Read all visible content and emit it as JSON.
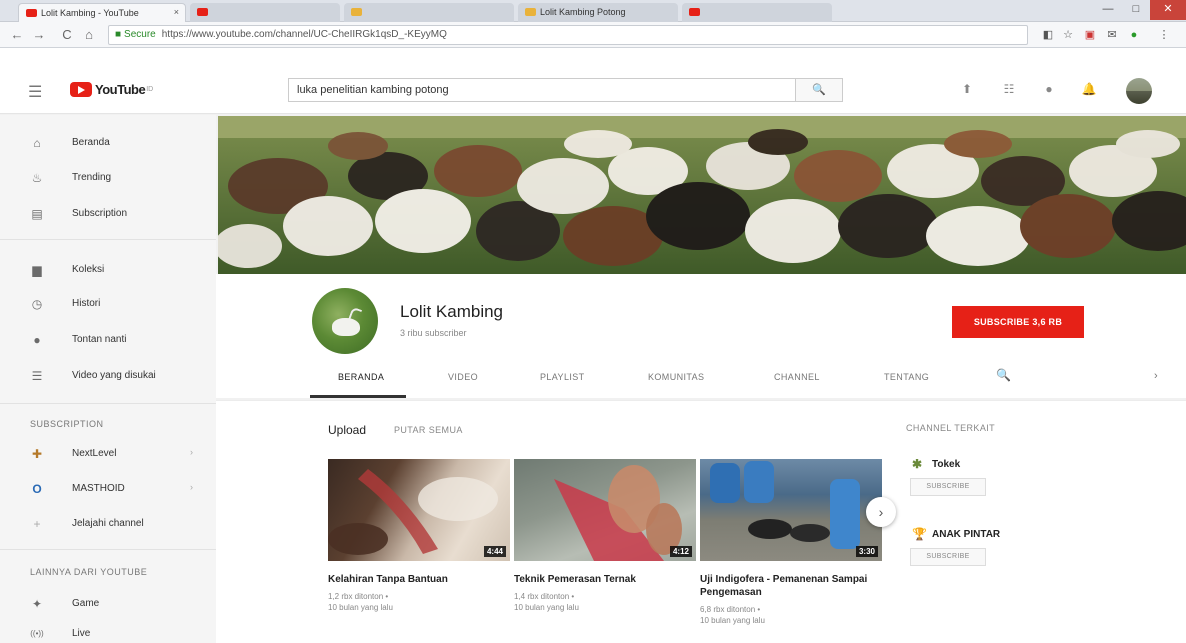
{
  "browser": {
    "tabs": [
      {
        "title": "Lolit Kambing - YouTube",
        "close": "×"
      },
      {
        "title": "",
        "close": ""
      },
      {
        "title": "",
        "close": ""
      },
      {
        "title": "Lolit Kambing Potong",
        "close": ""
      },
      {
        "title": "",
        "close": ""
      }
    ],
    "window_controls": [
      "—",
      "□",
      "✕"
    ],
    "back": "←",
    "forward": "→",
    "reload": "C",
    "home": "⌂",
    "secure_label": "Secure",
    "url": "https://www.youtube.com/channel/UC-CheIIRGk1qsD_-KEyyMQ",
    "extensions": [
      "◧",
      "☆",
      "▣",
      "✉",
      "●",
      "⋮"
    ]
  },
  "masthead": {
    "logo_text": "YouTube",
    "logo_region": "ID",
    "search_value": "luka penelitian kambing potong",
    "search_icon": "🔍",
    "icons": [
      "upload-icon",
      "apps-icon",
      "messages-icon",
      "notifications-icon"
    ]
  },
  "sidebar": {
    "main": [
      {
        "label": "Beranda",
        "icon": "home-icon",
        "glyph": "⌂"
      },
      {
        "label": "Trending",
        "icon": "flame-icon",
        "glyph": "♨"
      },
      {
        "label": "Subscription",
        "icon": "subscriptions-icon",
        "glyph": "▤"
      }
    ],
    "library": [
      {
        "label": "Koleksi",
        "icon": "folder-icon",
        "glyph": "▆"
      },
      {
        "label": "Histori",
        "icon": "history-icon",
        "glyph": "◷"
      },
      {
        "label": "Tontan nanti",
        "icon": "watch-later-icon",
        "glyph": "●"
      },
      {
        "label": "Video yang disukai",
        "icon": "liked-videos-icon",
        "glyph": "☰"
      }
    ],
    "subscription_heading": "SUBSCRIPTION",
    "subscriptions": [
      {
        "label": "NextLevel",
        "chevron": "›"
      },
      {
        "label": "MASTHOID",
        "chevron": "›"
      },
      {
        "label": "Jelajahi channel",
        "chevron": ""
      }
    ],
    "more_heading": "LAINNYA DARI YOUTUBE",
    "more": [
      {
        "label": "Game",
        "icon": "gaming-icon",
        "glyph": "✦"
      },
      {
        "label": "Live",
        "icon": "live-icon",
        "glyph": "((•))"
      }
    ]
  },
  "channel": {
    "name": "Lolit Kambing",
    "subscribers": "3 ribu subscriber",
    "subscribe_label": "SUBSCRIBE 3,6 RB",
    "tabs": [
      "BERANDA",
      "VIDEO",
      "PLAYLIST",
      "KOMUNITAS",
      "CHANNEL",
      "TENTANG"
    ],
    "search_icon": "🔍",
    "next_icon": "›"
  },
  "uploads": {
    "title": "Upload",
    "play_all": "PUTAR SEMUA",
    "next_icon": "›",
    "videos": [
      {
        "title": "Kelahiran Tanpa Bantuan",
        "views": "1,2 rbx ditonton •",
        "age": "10 bulan yang lalu",
        "duration": "4:44"
      },
      {
        "title": "Teknik Pemerasan Ternak",
        "views": "1,4 rbx ditonton •",
        "age": "10 bulan yang lalu",
        "duration": "4:12"
      },
      {
        "title": "Uji Indigofera - Pemanenan Sampai Pengemasan",
        "views": "6,8 rbx ditonton •",
        "age": "10 bulan yang lalu",
        "duration": "3:30"
      }
    ]
  },
  "related": {
    "title": "CHANNEL TERKAIT",
    "channels": [
      {
        "name": "Tokek",
        "glyph": "✱",
        "subscribe": "SUBSCRIBE"
      },
      {
        "name": "ANAK PINTAR",
        "glyph": "🏆",
        "subscribe": "SUBSCRIBE"
      }
    ]
  }
}
